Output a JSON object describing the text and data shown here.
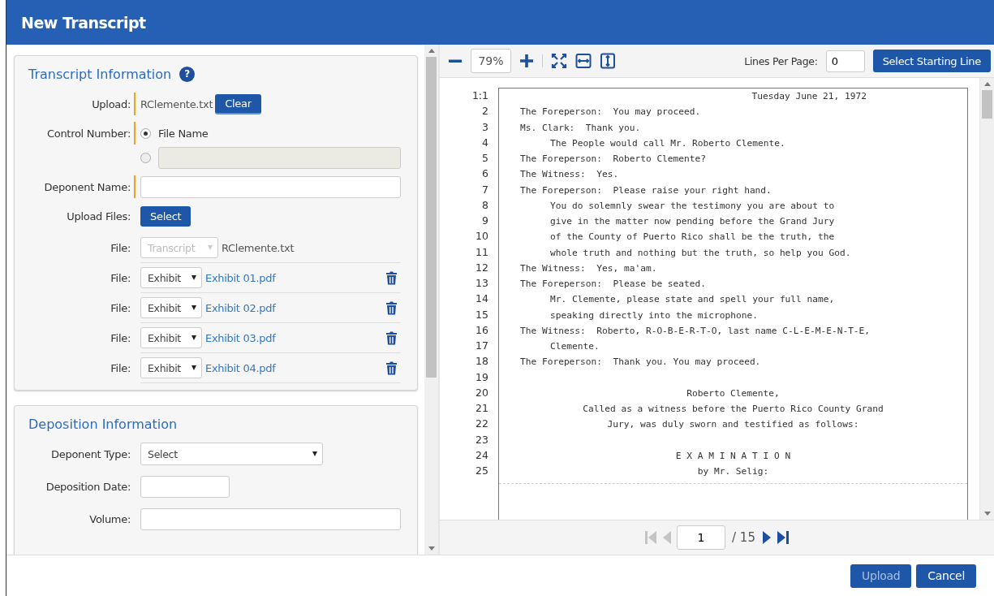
{
  "window": {
    "title": "New Transcript"
  },
  "transcript_info": {
    "title": "Transcript Information",
    "help": "?",
    "upload": {
      "label": "Upload:",
      "required": true,
      "file": "RClemente.txt",
      "button": "Clear"
    },
    "control_number": {
      "label": "Control Number:",
      "required": true,
      "options": [
        {
          "label": "File Name",
          "selected": true
        },
        {
          "selected": false
        }
      ]
    },
    "deponent_name": {
      "label": "Deponent Name:",
      "required": true
    },
    "upload_files": {
      "label": "Upload Files:",
      "button": "Select"
    },
    "files": [
      {
        "kind": "transcript",
        "label": "File:",
        "type": "Transcript",
        "disabled": true,
        "name": "RClemente.txt"
      },
      {
        "kind": "exhibit",
        "label": "File:",
        "type": "Exhibit",
        "disabled": false,
        "name": "Exhibit 01.pdf"
      },
      {
        "kind": "exhibit",
        "label": "File:",
        "type": "Exhibit",
        "disabled": false,
        "name": "Exhibit 02.pdf"
      },
      {
        "kind": "exhibit",
        "label": "File:",
        "type": "Exhibit",
        "disabled": false,
        "name": "Exhibit 03.pdf"
      },
      {
        "kind": "exhibit",
        "label": "File:",
        "type": "Exhibit",
        "disabled": false,
        "name": "Exhibit 04.pdf"
      }
    ]
  },
  "deposition_info": {
    "title": "Deposition Information",
    "fields": [
      {
        "kind": "select",
        "label": "Deponent Type:",
        "value": "Select"
      },
      {
        "kind": "date",
        "label": "Deposition Date:"
      },
      {
        "kind": "text",
        "label": "Volume:"
      }
    ]
  },
  "viewer": {
    "zoom": "79%",
    "lines_per_page_label": "Lines Per Page:",
    "lines_per_page": "0",
    "select_button": "Select Starting Line",
    "lines": [
      {
        "number": "1:1",
        "kind": "right",
        "text": "Tuesday June 21, 1972"
      },
      {
        "number": "2",
        "kind": "left",
        "text": "The Foreperson:  You may proceed."
      },
      {
        "number": "3",
        "kind": "left",
        "text": "Ms. Clark:  Thank you."
      },
      {
        "number": "4",
        "kind": "indent",
        "text": "The People would call Mr. Roberto Clemente."
      },
      {
        "number": "5",
        "kind": "left",
        "text": "The Foreperson:  Roberto Clemente?"
      },
      {
        "number": "6",
        "kind": "left",
        "text": "The Witness:  Yes."
      },
      {
        "number": "7",
        "kind": "left",
        "text": "The Foreperson:  Please raise your right hand."
      },
      {
        "number": "8",
        "kind": "indent",
        "text": "You do solemnly swear the testimony you are about to"
      },
      {
        "number": "9",
        "kind": "indent",
        "text": "give in the matter now pending before the Grand Jury"
      },
      {
        "number": "10",
        "kind": "indent",
        "text": "of the County of Puerto Rico shall be the truth, the"
      },
      {
        "number": "11",
        "kind": "indent",
        "text": "whole truth and nothing but the truth, so help you God."
      },
      {
        "number": "12",
        "kind": "left",
        "text": "The Witness:  Yes, ma'am."
      },
      {
        "number": "13",
        "kind": "left",
        "text": "The Foreperson:  Please be seated."
      },
      {
        "number": "14",
        "kind": "indent",
        "text": "Mr. Clemente, please state and spell your full name,"
      },
      {
        "number": "15",
        "kind": "indent",
        "text": "speaking directly into the microphone."
      },
      {
        "number": "16",
        "kind": "left",
        "text": "The Witness:  Roberto, R-O-B-E-R-T-O, last name C-L-E-M-E-N-T-E,"
      },
      {
        "number": "17",
        "kind": "indent",
        "text": "Clemente."
      },
      {
        "number": "18",
        "kind": "left",
        "text": "The Foreperson:  Thank you. You may proceed."
      },
      {
        "number": "19",
        "kind": "left"
      },
      {
        "number": "20",
        "kind": "center",
        "text": "Roberto Clemente,"
      },
      {
        "number": "21",
        "kind": "center",
        "text": "Called as a witness before the Puerto Rico County Grand"
      },
      {
        "number": "22",
        "kind": "center",
        "text": "Jury, was duly sworn and testified as follows:"
      },
      {
        "number": "23",
        "kind": "left"
      },
      {
        "number": "24",
        "kind": "center",
        "text": "E X A M I N A T I O N"
      },
      {
        "number": "25",
        "kind": "center",
        "text": "by Mr. Selig:"
      }
    ],
    "pager": {
      "page": "1",
      "total": "/ 15",
      "first_disabled": true,
      "prev_disabled": true
    }
  },
  "buttons": [
    {
      "label": "Upload",
      "disabled": true
    },
    {
      "label": "Cancel",
      "disabled": false
    }
  ]
}
